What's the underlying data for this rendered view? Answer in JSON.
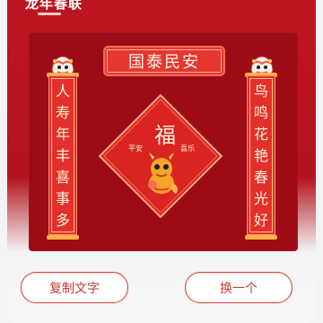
{
  "header": {
    "title": "龙年春联"
  },
  "banner": {
    "text": "国泰民安"
  },
  "couplets": {
    "left": [
      "人",
      "寿",
      "年",
      "丰",
      "喜",
      "事",
      "多"
    ],
    "right": [
      "鸟",
      "鸣",
      "花",
      "艳",
      "春",
      "光",
      "好"
    ]
  },
  "fu": {
    "main": "福",
    "small_left": "平安",
    "small_right": "喜乐"
  },
  "buttons": {
    "copy": "复制文字",
    "change": "换一个"
  },
  "colors": {
    "primary_red": "#bd1520",
    "panel_red": "#9d0b15",
    "accent_red": "#e3302c",
    "button_outline": "#d8453f"
  },
  "icons": {
    "lion_left": "lion-head-icon",
    "lion_right": "lion-head-icon",
    "dragon": "dragon-mascot-icon"
  }
}
